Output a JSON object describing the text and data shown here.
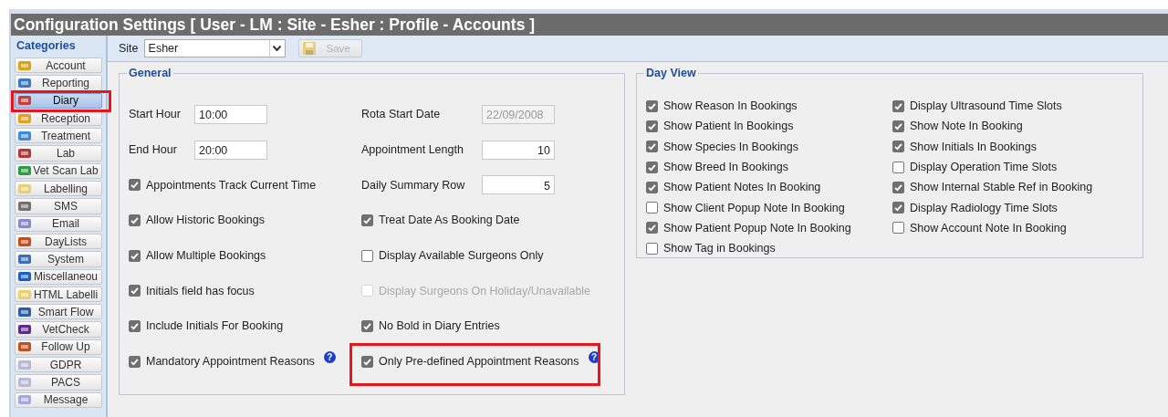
{
  "window": {
    "title": "Configuration Settings [ User - LM : Site - Esher : Profile - Accounts ]"
  },
  "sidebar": {
    "title": "Categories",
    "items": [
      {
        "label": "Account",
        "selected": false,
        "highlighted": false
      },
      {
        "label": "Reporting",
        "selected": false,
        "highlighted": false
      },
      {
        "label": "Diary",
        "selected": true,
        "highlighted": true
      },
      {
        "label": "Reception",
        "selected": false,
        "highlighted": false
      },
      {
        "label": "Treatment",
        "selected": false,
        "highlighted": false
      },
      {
        "label": "Lab",
        "selected": false,
        "highlighted": false
      },
      {
        "label": "Vet Scan Lab",
        "selected": false,
        "highlighted": false
      },
      {
        "label": "Labelling",
        "selected": false,
        "highlighted": false
      },
      {
        "label": "SMS",
        "selected": false,
        "highlighted": false
      },
      {
        "label": "Email",
        "selected": false,
        "highlighted": false
      },
      {
        "label": "DayLists",
        "selected": false,
        "highlighted": false
      },
      {
        "label": "System",
        "selected": false,
        "highlighted": false
      },
      {
        "label": "Miscellaneou",
        "selected": false,
        "highlighted": false
      },
      {
        "label": "HTML Labelli",
        "selected": false,
        "highlighted": false
      },
      {
        "label": "Smart Flow",
        "selected": false,
        "highlighted": false
      },
      {
        "label": "VetCheck",
        "selected": false,
        "highlighted": false
      },
      {
        "label": "Follow Up",
        "selected": false,
        "highlighted": false
      },
      {
        "label": "GDPR",
        "selected": false,
        "highlighted": false
      },
      {
        "label": "PACS",
        "selected": false,
        "highlighted": false
      },
      {
        "label": "Message",
        "selected": false,
        "highlighted": false
      }
    ]
  },
  "toolbar": {
    "site_label": "Site",
    "site_value": "Esher",
    "save": {
      "label": "Save",
      "disabled": true
    }
  },
  "general": {
    "title": "General",
    "columns": [
      [
        {
          "kind": "text_field",
          "label": "Start Hour",
          "value": "10:00",
          "disabled": false
        },
        {
          "kind": "text_field",
          "label": "End Hour",
          "value": "20:00",
          "disabled": false
        },
        {
          "kind": "checkbox",
          "label": "Appointments Track Current Time",
          "checked": true,
          "disabled": false,
          "highlighted": false
        },
        {
          "kind": "checkbox",
          "label": "Allow Historic Bookings",
          "checked": true,
          "disabled": false,
          "highlighted": false
        },
        {
          "kind": "checkbox",
          "label": "Allow Multiple Bookings",
          "checked": true,
          "disabled": false,
          "highlighted": false
        },
        {
          "kind": "checkbox",
          "label": "Initials field has focus",
          "checked": true,
          "disabled": false,
          "highlighted": false
        },
        {
          "kind": "checkbox",
          "label": "Include Initials For Booking",
          "checked": true,
          "disabled": false,
          "highlighted": false
        },
        {
          "kind": "checkbox",
          "label": "Mandatory Appointment Reasons",
          "checked": true,
          "disabled": false,
          "highlighted": false,
          "help": "?"
        }
      ],
      [
        {
          "kind": "text_field",
          "label": "Rota Start Date",
          "value": "22/09/2008",
          "disabled": true
        },
        {
          "kind": "number_field",
          "label": "Appointment Length",
          "value": "10",
          "disabled": false
        },
        {
          "kind": "number_field",
          "label": "Daily Summary Row",
          "value": "5",
          "disabled": false
        },
        {
          "kind": "checkbox",
          "label": "Treat Date As Booking Date",
          "checked": true,
          "disabled": false,
          "highlighted": false
        },
        {
          "kind": "checkbox",
          "label": "Display Available Surgeons Only",
          "checked": false,
          "disabled": false,
          "highlighted": false
        },
        {
          "kind": "checkbox",
          "label": "Display Surgeons On Holiday/Unavailable",
          "checked": false,
          "disabled": true,
          "highlighted": false
        },
        {
          "kind": "checkbox",
          "label": "No Bold in Diary Entries",
          "checked": true,
          "disabled": false,
          "highlighted": false
        },
        {
          "kind": "checkbox",
          "label": "Only Pre-defined Appointment Reasons",
          "checked": true,
          "disabled": false,
          "highlighted": true,
          "help": "?"
        }
      ]
    ]
  },
  "day_view": {
    "title": "Day View",
    "columns": [
      [
        {
          "label": "Show Reason In Bookings",
          "checked": true
        },
        {
          "label": "Show Patient In Bookings",
          "checked": true
        },
        {
          "label": "Show Species In Bookings",
          "checked": true
        },
        {
          "label": "Show Breed In Bookings",
          "checked": true
        },
        {
          "label": "Show Patient Notes In Booking",
          "checked": true
        },
        {
          "label": "Show Client Popup Note In Booking",
          "checked": false
        },
        {
          "label": "Show Patient Popup Note In Booking",
          "checked": true
        },
        {
          "label": "Show Tag in Bookings",
          "checked": false
        }
      ],
      [
        {
          "label": "Display Ultrasound Time Slots",
          "checked": true
        },
        {
          "label": "Show Note In Booking",
          "checked": true
        },
        {
          "label": "Show Initials In Bookings",
          "checked": true
        },
        {
          "label": "Display Operation Time Slots",
          "checked": false
        },
        {
          "label": "Show Internal Stable Ref in Booking",
          "checked": true
        },
        {
          "label": "Display Radiology Time Slots",
          "checked": true
        },
        {
          "label": "Show Account Note In Booking",
          "checked": false
        }
      ]
    ]
  }
}
